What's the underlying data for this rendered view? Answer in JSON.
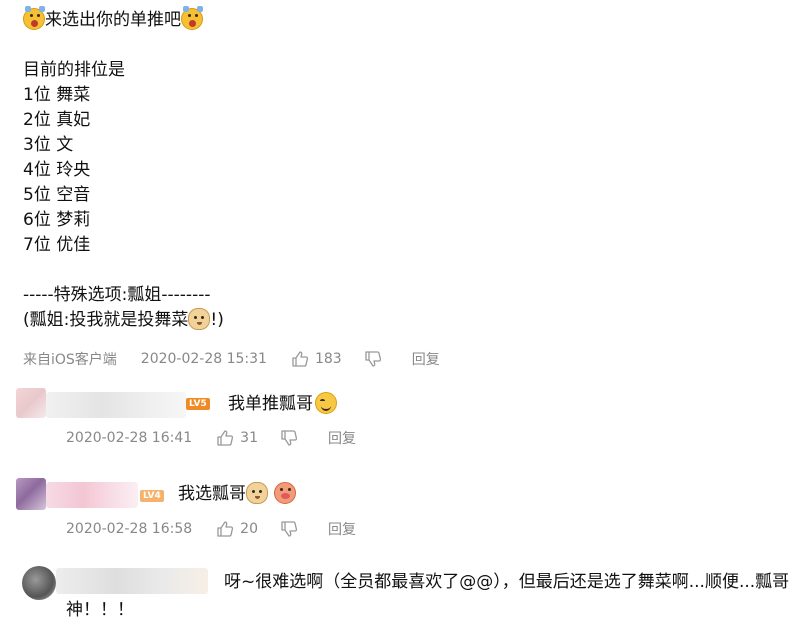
{
  "post": {
    "title": "来选出你的单推吧",
    "title_emoji": "shock-face-emoji",
    "ranking_heading": "目前的排位是",
    "rankings": [
      {
        "rank": "1位",
        "name": "舞菜"
      },
      {
        "rank": "2位",
        "name": "真妃"
      },
      {
        "rank": "3位",
        "name": "文"
      },
      {
        "rank": "4位",
        "name": "玲央"
      },
      {
        "rank": "5位",
        "name": "空音"
      },
      {
        "rank": "6位",
        "name": "梦莉"
      },
      {
        "rank": "7位",
        "name": "优佳"
      }
    ],
    "special_line": "-----特殊选项:瓢姐--------",
    "note_prefix": "(瓢姐:投我就是投舞菜",
    "note_emoji": "doge-emoji",
    "note_suffix": "!)",
    "meta": {
      "source": "来自iOS客户端",
      "time": "2020-02-28 15:31",
      "likes": "183",
      "reply_label": "回复"
    }
  },
  "comments": [
    {
      "level": "LV5",
      "level_color": "#f08a24",
      "text": "我单推瓢哥",
      "emoji": "smile-emoji",
      "time": "2020-02-28 16:41",
      "likes": "31",
      "reply_label": "回复"
    },
    {
      "level": "LV4",
      "level_color": "#f6b26b",
      "text": "我选瓢哥",
      "emojis": [
        "doge-emoji",
        "pig-emoji"
      ],
      "time": "2020-02-28 16:58",
      "likes": "20",
      "reply_label": "回复"
    },
    {
      "text_line1": "呀~很难选啊（全员都最喜欢了@@），但最后还是选了舞菜啊...顺便...瓢哥",
      "text_line2": "神！！！"
    }
  ],
  "colors": {
    "meta_text": "#888888",
    "body_text": "#111111"
  }
}
